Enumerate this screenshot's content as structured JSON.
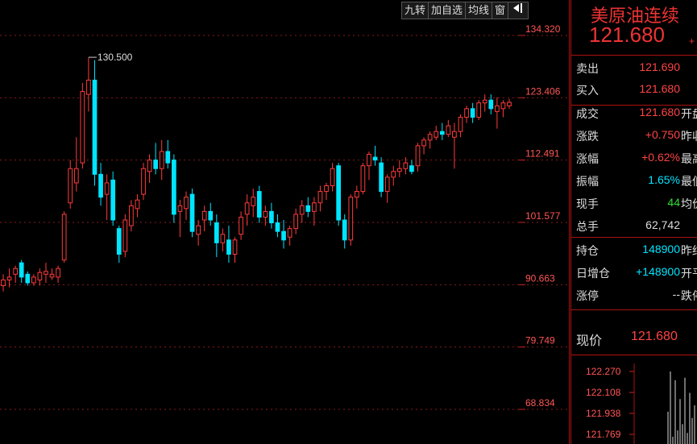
{
  "toolbar": {
    "btn1": "九转",
    "btn2": "加自选",
    "btn3": "均线",
    "btn4": "窗",
    "btn5_icon": "dock-panel-icon"
  },
  "panel": {
    "title": "美原油连续",
    "price": "121.680",
    "price_extra": "+",
    "rows": [
      {
        "label": "卖出",
        "value": "121.690",
        "color": "red",
        "extra": ""
      },
      {
        "label": "买入",
        "value": "121.680",
        "color": "red",
        "extra": ""
      },
      {
        "label": "成交",
        "value": "121.680",
        "color": "red",
        "extra": "开盘"
      },
      {
        "label": "涨跌",
        "value": "+0.750",
        "color": "red",
        "extra": "昨收"
      },
      {
        "label": "涨幅",
        "value": "+0.62%",
        "color": "red",
        "extra": "最高"
      },
      {
        "label": "振幅",
        "value": "1.65%",
        "color": "cyan",
        "extra": "最低"
      },
      {
        "label": "现手",
        "value": "44",
        "color": "green",
        "extra": "均价"
      },
      {
        "label": "总手",
        "value": "62,742",
        "color": "white",
        "extra": ""
      },
      {
        "label": "持仓",
        "value": "148900",
        "color": "cyan",
        "extra": "昨结"
      },
      {
        "label": "日增仓",
        "value": "+148900",
        "color": "cyan",
        "extra": "开平"
      },
      {
        "label": "涨停",
        "value": "--",
        "color": "white",
        "extra": "跌停"
      }
    ],
    "now_label": "现价",
    "now_value": "121.680",
    "mini": {
      "ticks": [
        "122.270",
        "122.108",
        "121.938",
        "121.769"
      ],
      "values": [
        121.95,
        122.27,
        121.75,
        122.2,
        121.8,
        122.05,
        121.85,
        122.22,
        121.78,
        122.1,
        121.9,
        122.0
      ]
    }
  },
  "chart_data": {
    "type": "candlestick",
    "yticks": [
      "134.320",
      "123.406",
      "112.491",
      "101.577",
      "90.663",
      "79.749",
      "68.834"
    ],
    "ylim": [
      68.834,
      134.32
    ],
    "max_annotation": "130.500",
    "colors": {
      "up": "#ff3b3b",
      "down": "#00e5ff",
      "grid": "#8b1a1a"
    },
    "candles": [
      {
        "o": 90.5,
        "h": 92.5,
        "l": 89.5,
        "c": 91.5
      },
      {
        "o": 91.5,
        "h": 93.5,
        "l": 90.2,
        "c": 92.0
      },
      {
        "o": 92.5,
        "h": 94.0,
        "l": 91.0,
        "c": 93.5
      },
      {
        "o": 94.5,
        "h": 95.0,
        "l": 91.0,
        "c": 92.0
      },
      {
        "o": 92.5,
        "h": 93.0,
        "l": 90.5,
        "c": 91.0
      },
      {
        "o": 91.0,
        "h": 92.5,
        "l": 90.5,
        "c": 92.0
      },
      {
        "o": 91.5,
        "h": 93.5,
        "l": 90.5,
        "c": 92.8
      },
      {
        "o": 92.5,
        "h": 94.5,
        "l": 91.0,
        "c": 93.0
      },
      {
        "o": 92.0,
        "h": 93.5,
        "l": 91.5,
        "c": 92.5
      },
      {
        "o": 92.0,
        "h": 94.0,
        "l": 91.0,
        "c": 93.5
      },
      {
        "o": 95.0,
        "h": 103.5,
        "l": 94.5,
        "c": 103.0
      },
      {
        "o": 105.0,
        "h": 112.5,
        "l": 104.0,
        "c": 111.0
      },
      {
        "o": 108.5,
        "h": 116.5,
        "l": 107.0,
        "c": 111.0
      },
      {
        "o": 112.0,
        "h": 126.0,
        "l": 111.0,
        "c": 124.5
      },
      {
        "o": 124.0,
        "h": 130.5,
        "l": 121.0,
        "c": 126.5
      },
      {
        "o": 126.5,
        "h": 130.0,
        "l": 108.0,
        "c": 110.0
      },
      {
        "o": 110.0,
        "h": 112.0,
        "l": 104.5,
        "c": 106.0
      },
      {
        "o": 106.5,
        "h": 110.0,
        "l": 102.0,
        "c": 108.5
      },
      {
        "o": 109.0,
        "h": 110.5,
        "l": 101.0,
        "c": 102.0
      },
      {
        "o": 100.5,
        "h": 101.0,
        "l": 94.5,
        "c": 96.0
      },
      {
        "o": 96.5,
        "h": 103.0,
        "l": 95.5,
        "c": 102.0
      },
      {
        "o": 101.0,
        "h": 105.5,
        "l": 100.0,
        "c": 104.5
      },
      {
        "o": 104.0,
        "h": 106.5,
        "l": 102.5,
        "c": 105.5
      },
      {
        "o": 106.5,
        "h": 112.0,
        "l": 105.5,
        "c": 111.0
      },
      {
        "o": 110.5,
        "h": 113.5,
        "l": 108.5,
        "c": 112.5
      },
      {
        "o": 112.5,
        "h": 115.5,
        "l": 110.0,
        "c": 111.0
      },
      {
        "o": 111.0,
        "h": 116.0,
        "l": 109.0,
        "c": 114.0
      },
      {
        "o": 114.0,
        "h": 116.0,
        "l": 111.0,
        "c": 112.0
      },
      {
        "o": 112.5,
        "h": 113.5,
        "l": 101.5,
        "c": 103.0
      },
      {
        "o": 103.5,
        "h": 105.5,
        "l": 99.0,
        "c": 104.5
      },
      {
        "o": 104.0,
        "h": 107.0,
        "l": 102.0,
        "c": 106.0
      },
      {
        "o": 106.5,
        "h": 107.5,
        "l": 99.0,
        "c": 100.0
      },
      {
        "o": 99.5,
        "h": 102.0,
        "l": 97.5,
        "c": 101.0
      },
      {
        "o": 102.0,
        "h": 104.5,
        "l": 100.0,
        "c": 103.5
      },
      {
        "o": 103.5,
        "h": 105.0,
        "l": 101.0,
        "c": 102.0
      },
      {
        "o": 101.5,
        "h": 103.0,
        "l": 95.5,
        "c": 98.0
      },
      {
        "o": 98.0,
        "h": 100.5,
        "l": 96.5,
        "c": 99.5
      },
      {
        "o": 98.5,
        "h": 101.0,
        "l": 94.5,
        "c": 96.0
      },
      {
        "o": 96.0,
        "h": 99.0,
        "l": 94.5,
        "c": 98.5
      },
      {
        "o": 99.5,
        "h": 103.5,
        "l": 98.5,
        "c": 102.5
      },
      {
        "o": 103.0,
        "h": 106.5,
        "l": 101.0,
        "c": 105.0
      },
      {
        "o": 104.5,
        "h": 107.5,
        "l": 102.5,
        "c": 106.0
      },
      {
        "o": 107.0,
        "h": 108.0,
        "l": 101.5,
        "c": 102.5
      },
      {
        "o": 102.5,
        "h": 104.5,
        "l": 101.0,
        "c": 103.5
      },
      {
        "o": 103.5,
        "h": 105.0,
        "l": 100.5,
        "c": 101.5
      },
      {
        "o": 101.5,
        "h": 103.0,
        "l": 99.0,
        "c": 100.0
      },
      {
        "o": 100.0,
        "h": 102.0,
        "l": 97.0,
        "c": 98.5
      },
      {
        "o": 99.0,
        "h": 101.0,
        "l": 97.5,
        "c": 100.5
      },
      {
        "o": 100.5,
        "h": 104.0,
        "l": 99.5,
        "c": 103.0
      },
      {
        "o": 103.0,
        "h": 105.5,
        "l": 101.5,
        "c": 104.5
      },
      {
        "o": 104.5,
        "h": 106.0,
        "l": 102.5,
        "c": 103.5
      },
      {
        "o": 103.5,
        "h": 106.0,
        "l": 101.0,
        "c": 105.0
      },
      {
        "o": 105.0,
        "h": 108.0,
        "l": 103.5,
        "c": 107.0
      },
      {
        "o": 107.0,
        "h": 108.5,
        "l": 105.5,
        "c": 108.0
      },
      {
        "o": 108.0,
        "h": 112.0,
        "l": 107.0,
        "c": 111.0
      },
      {
        "o": 111.5,
        "h": 112.0,
        "l": 101.0,
        "c": 102.0
      },
      {
        "o": 102.0,
        "h": 103.0,
        "l": 97.0,
        "c": 98.5
      },
      {
        "o": 98.5,
        "h": 106.5,
        "l": 97.5,
        "c": 106.0
      },
      {
        "o": 106.0,
        "h": 108.0,
        "l": 104.0,
        "c": 107.0
      },
      {
        "o": 107.0,
        "h": 112.0,
        "l": 106.5,
        "c": 111.5
      },
      {
        "o": 111.5,
        "h": 114.0,
        "l": 109.0,
        "c": 113.5
      },
      {
        "o": 113.0,
        "h": 115.0,
        "l": 111.5,
        "c": 112.5
      },
      {
        "o": 112.0,
        "h": 113.0,
        "l": 106.0,
        "c": 107.0
      },
      {
        "o": 107.0,
        "h": 110.0,
        "l": 105.0,
        "c": 109.5
      },
      {
        "o": 109.5,
        "h": 111.5,
        "l": 108.0,
        "c": 110.5
      },
      {
        "o": 110.5,
        "h": 112.5,
        "l": 109.5,
        "c": 111.0
      },
      {
        "o": 111.0,
        "h": 113.0,
        "l": 110.0,
        "c": 112.0
      },
      {
        "o": 111.5,
        "h": 112.5,
        "l": 110.0,
        "c": 110.5
      },
      {
        "o": 111.5,
        "h": 115.5,
        "l": 110.5,
        "c": 115.0
      },
      {
        "o": 115.0,
        "h": 116.5,
        "l": 113.5,
        "c": 116.0
      },
      {
        "o": 116.0,
        "h": 117.5,
        "l": 114.5,
        "c": 117.0
      },
      {
        "o": 116.5,
        "h": 118.5,
        "l": 116.0,
        "c": 117.5
      },
      {
        "o": 117.5,
        "h": 119.0,
        "l": 116.0,
        "c": 117.0
      },
      {
        "o": 117.0,
        "h": 119.5,
        "l": 116.5,
        "c": 118.5
      },
      {
        "o": 116.5,
        "h": 119.0,
        "l": 111.0,
        "c": 117.5
      },
      {
        "o": 117.5,
        "h": 120.5,
        "l": 116.5,
        "c": 120.0
      },
      {
        "o": 120.0,
        "h": 122.0,
        "l": 119.0,
        "c": 121.5
      },
      {
        "o": 121.5,
        "h": 122.5,
        "l": 119.0,
        "c": 120.0
      },
      {
        "o": 120.0,
        "h": 123.0,
        "l": 119.5,
        "c": 122.5
      },
      {
        "o": 122.5,
        "h": 124.0,
        "l": 121.0,
        "c": 123.0
      },
      {
        "o": 123.0,
        "h": 124.0,
        "l": 120.5,
        "c": 121.5
      },
      {
        "o": 121.0,
        "h": 123.5,
        "l": 118.0,
        "c": 122.0
      },
      {
        "o": 121.5,
        "h": 123.0,
        "l": 120.0,
        "c": 122.5
      },
      {
        "o": 122.0,
        "h": 123.2,
        "l": 121.5,
        "c": 122.6
      }
    ]
  }
}
